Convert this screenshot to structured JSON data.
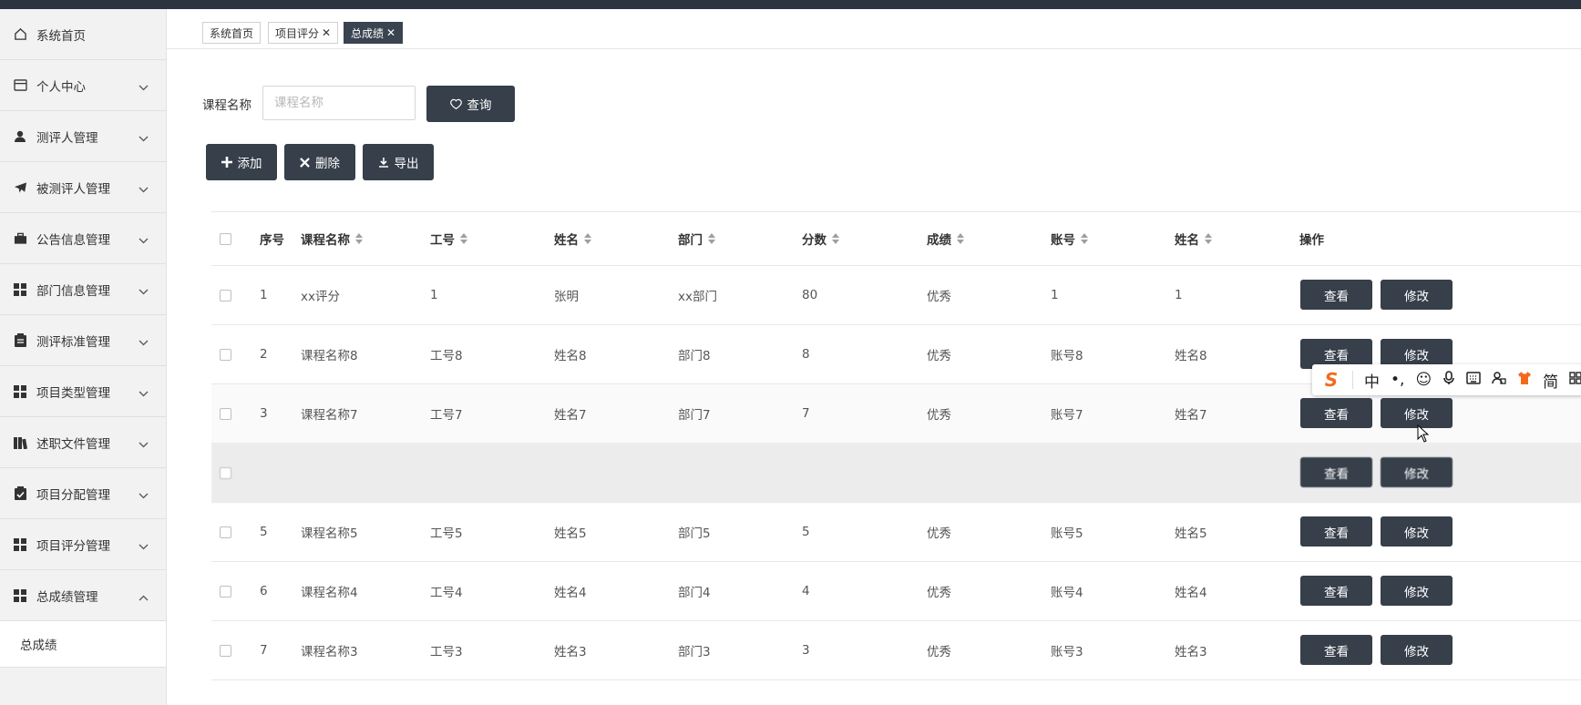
{
  "sidebar": {
    "items": [
      {
        "label": "系统首页",
        "icon": "home-icon",
        "expandable": false
      },
      {
        "label": "个人中心",
        "icon": "wallet-icon",
        "expandable": true
      },
      {
        "label": "测评人管理",
        "icon": "user-icon",
        "expandable": true
      },
      {
        "label": "被测评人管理",
        "icon": "paper-plane-icon",
        "expandable": true
      },
      {
        "label": "公告信息管理",
        "icon": "briefcase-icon",
        "expandable": true
      },
      {
        "label": "部门信息管理",
        "icon": "grid-icon",
        "expandable": true
      },
      {
        "label": "测评标准管理",
        "icon": "clipboard-icon",
        "expandable": true
      },
      {
        "label": "项目类型管理",
        "icon": "grid-icon",
        "expandable": true
      },
      {
        "label": "述职文件管理",
        "icon": "books-icon",
        "expandable": true
      },
      {
        "label": "项目分配管理",
        "icon": "clipboard-check-icon",
        "expandable": true
      },
      {
        "label": "项目评分管理",
        "icon": "grid-icon",
        "expandable": true
      },
      {
        "label": "总成绩管理",
        "icon": "grid-icon",
        "expandable": true,
        "expanded": true
      }
    ],
    "submenu": [
      "总成绩"
    ]
  },
  "tabs": [
    {
      "label": "系统首页",
      "closable": false
    },
    {
      "label": "项目评分",
      "closable": true
    },
    {
      "label": "总成绩",
      "closable": true,
      "active": true
    }
  ],
  "search": {
    "label": "课程名称",
    "placeholder": "课程名称",
    "value": "",
    "button": "查询"
  },
  "actions": {
    "add": "添加",
    "delete": "删除",
    "export": "导出"
  },
  "table": {
    "headers": [
      "序号",
      "课程名称",
      "工号",
      "姓名",
      "部门",
      "分数",
      "成绩",
      "账号",
      "姓名",
      "操作"
    ],
    "view_label": "查看",
    "edit_label": "修改",
    "rows": [
      [
        "1",
        "xx评分",
        "1",
        "张明",
        "xx部门",
        "80",
        "优秀",
        "1",
        "1"
      ],
      [
        "2",
        "课程名称8",
        "工号8",
        "姓名8",
        "部门8",
        "8",
        "优秀",
        "账号8",
        "姓名8"
      ],
      [
        "3",
        "课程名称7",
        "工号7",
        "姓名7",
        "部门7",
        "7",
        "优秀",
        "账号7",
        "姓名7"
      ],
      [
        "",
        "",
        "",
        "",
        "",
        "",
        "",
        "",
        ""
      ],
      [
        "5",
        "课程名称5",
        "工号5",
        "姓名5",
        "部门5",
        "5",
        "优秀",
        "账号5",
        "姓名5"
      ],
      [
        "6",
        "课程名称4",
        "工号4",
        "姓名4",
        "部门4",
        "4",
        "优秀",
        "账号4",
        "姓名4"
      ],
      [
        "7",
        "课程名称3",
        "工号3",
        "姓名3",
        "部门3",
        "3",
        "优秀",
        "账号3",
        "姓名3"
      ]
    ]
  },
  "ime_toolbar": {
    "items": [
      "中",
      "简"
    ]
  },
  "colors": {
    "primary_button": "#363f4a",
    "sidebar_bg": "#f2f2f2",
    "topbar": "#2b3440"
  }
}
